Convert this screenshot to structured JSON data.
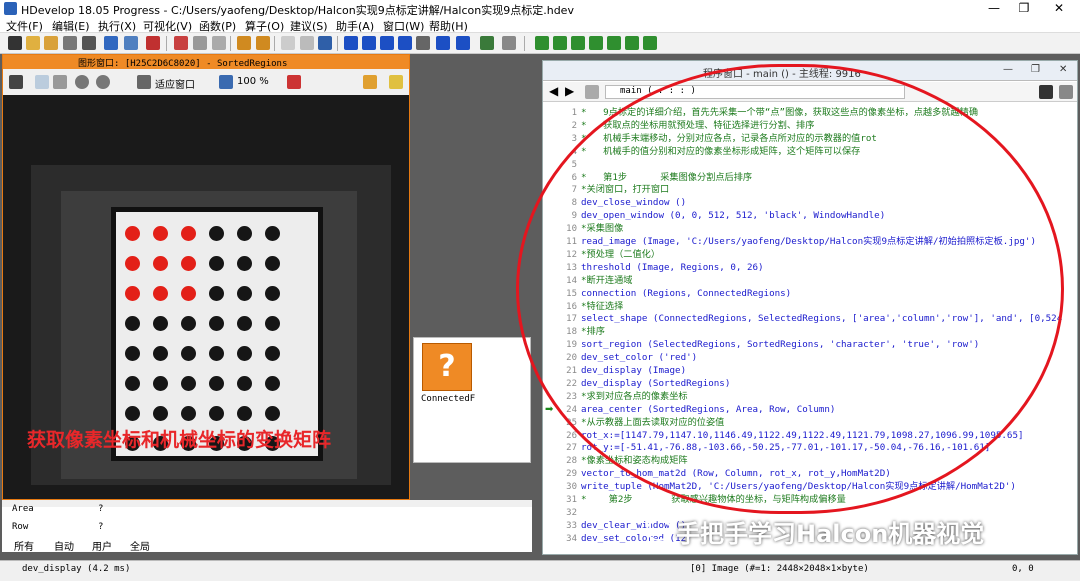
{
  "window": {
    "title": "HDevelop 18.05 Progress - C:/Users/yaofeng/Desktop/Halcon实现9点标定讲解/Halcon实现9点标定.hdev"
  },
  "menu": [
    "文件(F)",
    "编辑(E)",
    "执行(X)",
    "可视化(V)",
    "函数(P)",
    "算子(O)",
    "建议(S)",
    "助手(A)",
    "窗口(W)",
    "帮助(H)"
  ],
  "graphics_window": {
    "title": "图形窗口: [H25C2D6C8020] - SortedRegions",
    "fit_label": "适应窗口",
    "zoom": "100 %",
    "overlay_text": "获取像素坐标和机械坐标的变换矩阵"
  },
  "operator_window": {
    "label": "ConnectedF"
  },
  "variables": [
    {
      "name": "Area",
      "value": "?"
    },
    {
      "name": "Row",
      "value": "?"
    }
  ],
  "var_tabs": [
    "所有",
    "自动",
    "用户",
    "全局"
  ],
  "program_window": {
    "title": "程序窗口 - main () - 主线程: 9916",
    "proc": "main ( : : : )",
    "lines": [
      {
        "n": "1",
        "t": "*   9点标定的详细介绍，首先先采集一个带“点”图像，获取这些点的像素坐标，点越多就越精确",
        "k": "cmt"
      },
      {
        "n": "2",
        "t": "*   获取点的坐标用就预处理、特征选择进行分割、排序",
        "k": "cmt"
      },
      {
        "n": "3",
        "t": "*   机械手末端移动，分别对应各点，记录各点所对应的示教器的值rot",
        "k": "cmt"
      },
      {
        "n": "4",
        "t": "*   机械手的值分别和对应的像素坐标形成矩阵，这个矩阵可以保存",
        "k": "cmt"
      },
      {
        "n": "5",
        "t": "",
        "k": ""
      },
      {
        "n": "6",
        "t": "*   第1步      采集图像分割点后排序",
        "k": "cmt"
      },
      {
        "n": "7",
        "t": "*关闭窗口，打开窗口",
        "k": "cmt"
      },
      {
        "n": "8",
        "t": "dev_close_window ()",
        "k": "op"
      },
      {
        "n": "9",
        "t": "dev_open_window (0, 0, 512, 512, 'black', WindowHandle)",
        "k": "op"
      },
      {
        "n": "10",
        "t": "*采集图像",
        "k": "cmt"
      },
      {
        "n": "11",
        "t": "read_image (Image, 'C:/Users/yaofeng/Desktop/Halcon实现9点标定讲解/初始拍照标定板.jpg')",
        "k": "op"
      },
      {
        "n": "12",
        "t": "*预处理（二值化）",
        "k": "cmt"
      },
      {
        "n": "13",
        "t": "threshold (Image, Regions, 0, 26)",
        "k": "op"
      },
      {
        "n": "14",
        "t": "*断开连通域",
        "k": "cmt"
      },
      {
        "n": "15",
        "t": "connection (Regions, ConnectedRegions)",
        "k": "op"
      },
      {
        "n": "16",
        "t": "*特征选择",
        "k": "cmt"
      },
      {
        "n": "17",
        "t": "select_shape (ConnectedRegions, SelectedRegions, ['area','column','row'], 'and', [0,524",
        "k": "op"
      },
      {
        "n": "18",
        "t": "*排序",
        "k": "cmt"
      },
      {
        "n": "19",
        "t": "sort_region (SelectedRegions, SortedRegions, 'character', 'true', 'row')",
        "k": "op"
      },
      {
        "n": "20",
        "t": "dev_set_color ('red')",
        "k": "op"
      },
      {
        "n": "21",
        "t": "dev_display (Image)",
        "k": "op"
      },
      {
        "n": "22",
        "t": "dev_display (SortedRegions)",
        "k": "op"
      },
      {
        "n": "23",
        "t": "*求到对应各点的像素坐标",
        "k": "cmt"
      },
      {
        "n": "24",
        "t": "area_center (SortedRegions, Area, Row, Column)",
        "k": "op"
      },
      {
        "n": "25",
        "t": "*从示教器上面去读取对应的位姿值",
        "k": "cmt"
      },
      {
        "n": "26",
        "t": "rot_x:=[1147.79,1147.10,1146.49,1122.49,1122.49,1121.79,1098.27,1096.99,1095.65]",
        "k": "op"
      },
      {
        "n": "27",
        "t": "rot_y:=[-51.41,-76.88,-103.66,-50.25,-77.01,-101.17,-50.04,-76.16,-101.61]",
        "k": "op"
      },
      {
        "n": "28",
        "t": "*像素坐标和姿态构成矩阵",
        "k": "cmt"
      },
      {
        "n": "29",
        "t": "vector_to_hom_mat2d (Row, Column, rot_x, rot_y,HomMat2D)",
        "k": "op"
      },
      {
        "n": "30",
        "t": "write_tuple (HomMat2D, 'C:/Users/yaofeng/Desktop/Halcon实现9点标定讲解/HomMat2D')",
        "k": "op"
      },
      {
        "n": "31",
        "t": "*    第2步       获取感兴趣物体的坐标，与矩阵构成偏移量",
        "k": "cmt"
      },
      {
        "n": "32",
        "t": "",
        "k": ""
      },
      {
        "n": "33",
        "t": "dev_clear_window ()",
        "k": "op"
      },
      {
        "n": "34",
        "t": "dev_set_colored (12)",
        "k": "op"
      }
    ]
  },
  "status": {
    "left": "dev_display (4.2 ms)",
    "image_info": "[0] Image (#=1: 2448×2048×1×byte)",
    "coords": "0, 0"
  },
  "watermark": "手把手学习Halcon机器视觉",
  "colors": {
    "accent": "#ef8a25",
    "highlight": "#e4161f"
  }
}
